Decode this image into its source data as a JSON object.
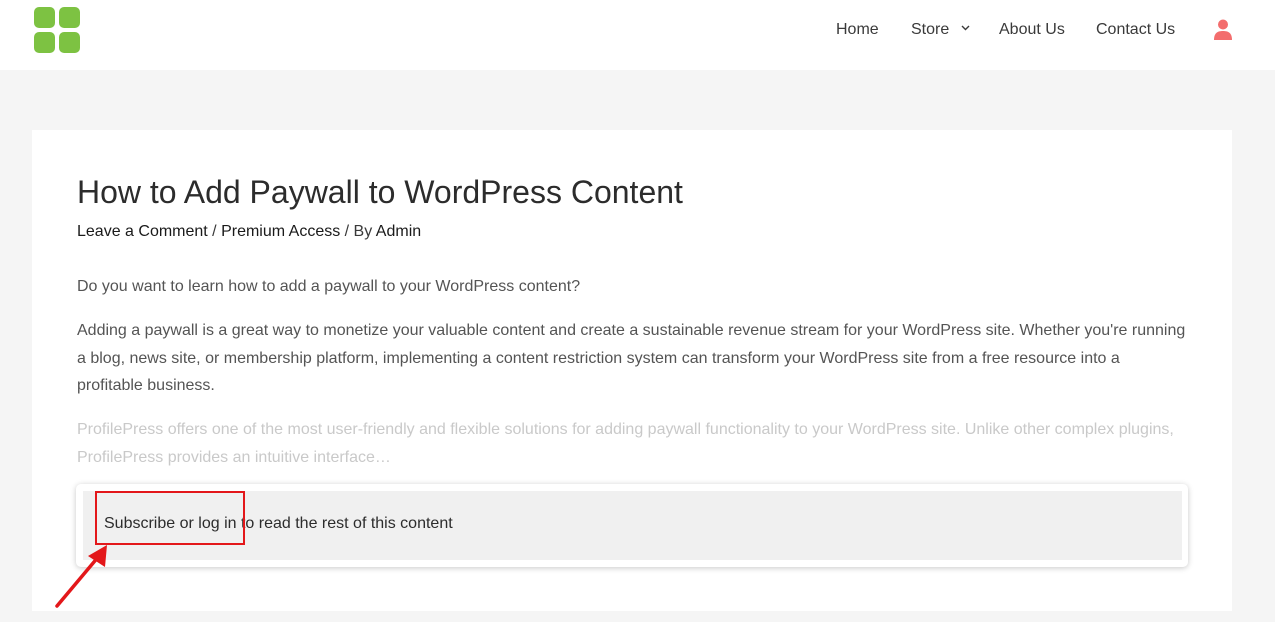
{
  "nav": {
    "home": "Home",
    "store": "Store",
    "about": "About Us",
    "contact": "Contact Us"
  },
  "post": {
    "title": "How to Add Paywall to WordPress Content",
    "meta": {
      "comment_link": "Leave a Comment",
      "sep1": " / ",
      "category": "Premium Access",
      "sep2": " / By ",
      "author": "Admin"
    },
    "paragraphs": [
      "Do you want to learn how to add a paywall to your WordPress content?",
      "Adding a paywall is a great way to monetize your valuable content and create a sustainable revenue stream for your WordPress site. Whether you're running a blog, news site, or membership platform, implementing a content restriction system can transform your WordPress site from a free resource into a profitable business.",
      "ProfilePress offers one of the most user-friendly and flexible solutions for adding paywall functionality to your WordPress site. Unlike other complex plugins, ProfilePress provides an intuitive interface…"
    ]
  },
  "paywall": {
    "subscribe": "Subscribe",
    "or": " or ",
    "login": "log in",
    "rest": " to read the rest of this content"
  },
  "colors": {
    "logo": "#7dc242",
    "accent": "#e3171a",
    "user_icon": "#f36d6d"
  },
  "icons": [
    "logo-icon",
    "chevron-down-icon",
    "user-icon",
    "arrow-icon"
  ]
}
